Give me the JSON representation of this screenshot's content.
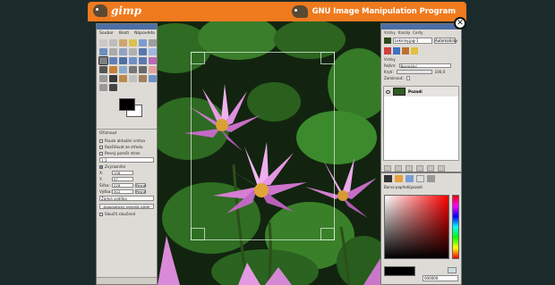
{
  "banner": {
    "logo_text": "gimp",
    "title": "GNU Image Manipulation Program",
    "close_glyph": "✕"
  },
  "toolbox": {
    "menus": [
      "Soubor",
      "Bosti",
      "Nápověda"
    ],
    "fg_color": "#000000",
    "bg_color": "#ffffff",
    "options": {
      "title": "Ořiznout",
      "opt_current_layer": "Pouze aktuální vrstva",
      "opt_expand_center": "Rozšiřovat ze středu",
      "opt_fixed": "Pevný poměr stran",
      "ratio_value": "1:1",
      "opt_shrink": "Zvýraznění",
      "x_label": "X:",
      "x_value": "156",
      "y_label": "Y:",
      "y_value": "57",
      "w_label": "Šířka:",
      "w_value": "226",
      "h_label": "Výška:",
      "h_value": "302",
      "fixed_btn": "Pevné",
      "fixed_btn2": "Pevné",
      "guides_value": "Žádná vodítka",
      "auto_shrink_btn": "Automaticky zmenšit výběr",
      "merged_label": "Sloučit sloučené"
    }
  },
  "layers": {
    "tabs": [
      "Vrstvy",
      "Kanály",
      "Cesty"
    ],
    "image_select": "Lekníny.jpg-1",
    "auto_btn": "Automaticky",
    "mode_label": "Režim:",
    "mode_value": "Normální",
    "opacity_label": "Krytí:",
    "opacity_value": "100,0",
    "lock_label": "Zamknout:",
    "layers_label": "Vrstvy",
    "layer_name": "Pozadí"
  },
  "colors": {
    "label": "Barva popředí/pozadí",
    "hex_value": "000000",
    "current": "#000000"
  }
}
